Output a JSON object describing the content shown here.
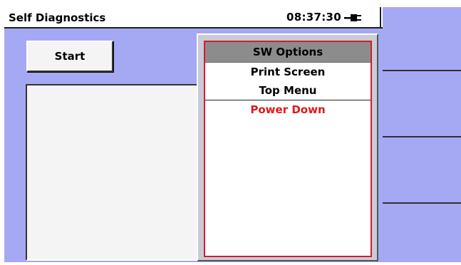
{
  "titlebar": {
    "title": "Self Diagnostics",
    "clock": "08:37:30",
    "power_icon": "ac-plug-icon"
  },
  "main": {
    "start_label": "Start",
    "results_text": ""
  },
  "popup": {
    "header": "SW Options",
    "items": [
      {
        "label": "Print Screen"
      },
      {
        "label": "Top Menu"
      },
      {
        "label": "Power Down"
      }
    ],
    "danger_color": "#e01818"
  },
  "soft_keys": [
    "",
    "",
    "",
    ""
  ]
}
